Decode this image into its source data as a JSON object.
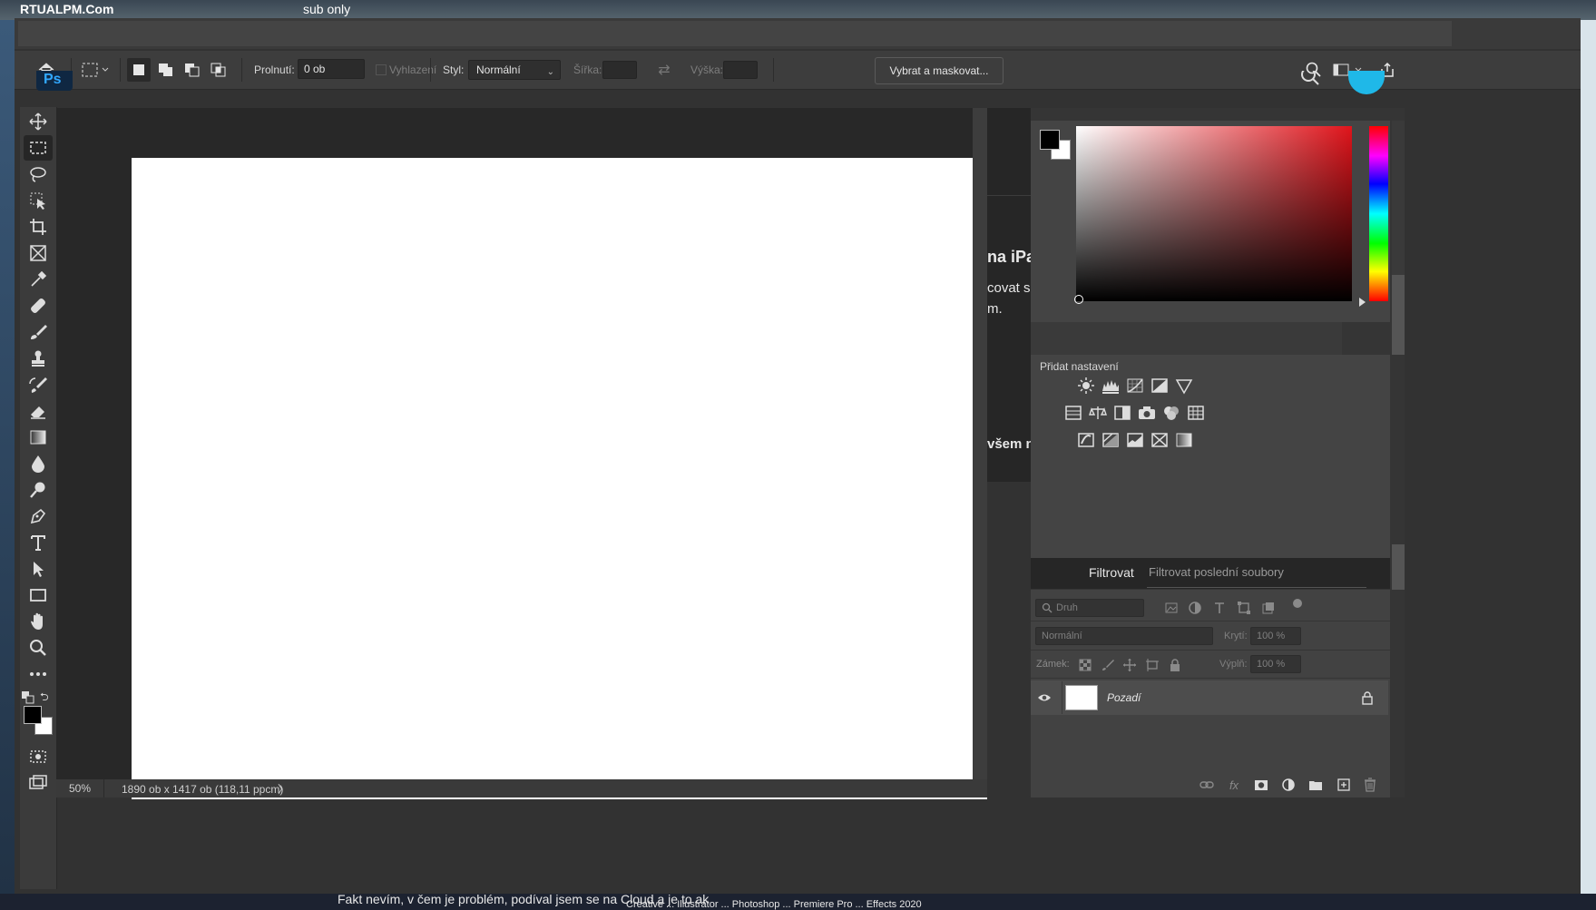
{
  "options_bar": {
    "feather_label": "Prolnutí:",
    "feather_value": "0 ob",
    "antialias_label": "Vyhlazení",
    "style_label": "Styl:",
    "style_value": "Normální",
    "width_label": "Šířka:",
    "height_label": "Výška:",
    "refine_button": "Vybrat a maskovat..."
  },
  "background_page": {
    "title_fragment": "na iPa",
    "line1": "covat s",
    "line2": "m.",
    "line3": "všem n",
    "bottom_text": "Fakt nevím, v čem je problém, podíval jsem se na Cloud a je to ak",
    "bottom_text2": "Creative    ... Illustrator ... Photoshop ... Premiere Pro ... Effects 2020",
    "top_left": "RTUALPM.Com",
    "top_mid": "sub only"
  },
  "adjustments": {
    "title": "Přidat nastavení"
  },
  "filter": {
    "label": "Filtrovat",
    "placeholder": "Filtrovat poslední soubory"
  },
  "layers": {
    "kind_label": "Druh",
    "blend_mode": "Normální",
    "opacity_label": "Krytí:",
    "opacity_value": "100 %",
    "lock_label": "Zámek:",
    "fill_label": "Výplň:",
    "fill_value": "100 %",
    "items": [
      {
        "name": "Pozadí",
        "visible": true,
        "locked": true
      }
    ]
  },
  "status": {
    "zoom": "50%",
    "doc_info": "1890 ob x 1417 ob (118,11 ppcm)",
    "arrow": "〉"
  },
  "colors": {
    "foreground": "#000000",
    "background": "#ffffff",
    "picker_hue": "#e0141b"
  }
}
